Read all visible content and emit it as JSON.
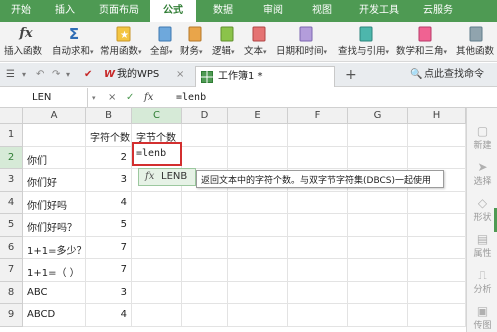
{
  "menu": {
    "tabs": [
      "开始",
      "插入",
      "页面布局",
      "公式",
      "数据",
      "审阅",
      "视图",
      "开发工具",
      "云服务"
    ],
    "active_index": 3
  },
  "ribbon": {
    "insert_function": "插入函数",
    "autosum": "自动求和",
    "common_functions": "常用函数",
    "all": "全部",
    "finance": "财务",
    "logic": "逻辑",
    "text": "文本",
    "datetime": "日期和时间",
    "lookup": "查找与引用",
    "math": "数学和三角",
    "other": "其他函数",
    "autosum_symbol": "Σ",
    "fx_symbol": "fx",
    "caret": "▾"
  },
  "doc_tabs": {
    "my_wps": "我的WPS",
    "workbook": "工作簿1 *",
    "add": "+",
    "search_placeholder": "点此查找命令",
    "close": "×"
  },
  "formula_bar": {
    "name_box": "LEN",
    "cancel": "×",
    "confirm": "✓",
    "fx": "fx",
    "formula": "=lenb"
  },
  "sheet": {
    "columns": [
      "A",
      "B",
      "C",
      "D",
      "E",
      "F",
      "G",
      "H"
    ],
    "rows": [
      {
        "n": "1",
        "a": "",
        "b": "字符个数",
        "c": "字节个数"
      },
      {
        "n": "2",
        "a": "你们",
        "b": "2",
        "c": "=lenb"
      },
      {
        "n": "3",
        "a": "你们好",
        "b": "3",
        "c": ""
      },
      {
        "n": "4",
        "a": "你们好吗",
        "b": "4",
        "c": ""
      },
      {
        "n": "5",
        "a": "你们好吗？",
        "b": "5",
        "c": ""
      },
      {
        "n": "6",
        "a": "1+1=多少？",
        "b": "7",
        "c": ""
      },
      {
        "n": "7",
        "a": "1+1=（ ）",
        "b": "7",
        "c": ""
      },
      {
        "n": "8",
        "a": "ABC",
        "b": "3",
        "c": ""
      },
      {
        "n": "9",
        "a": "ABCD",
        "b": "4",
        "c": ""
      }
    ]
  },
  "autocomplete": {
    "fx": "fx",
    "function_name": "LENB",
    "tooltip": "返回文本中的字符个数。与双字节字符集(DBCS)一起使用"
  },
  "side_panel": {
    "items": [
      "新建",
      "选择",
      "形状",
      "属性",
      "分析",
      "传图"
    ]
  },
  "colors": {
    "menu_green": "#4e9a53",
    "active_border": "#d32f2f",
    "selection_green": "#2e8b3a"
  }
}
